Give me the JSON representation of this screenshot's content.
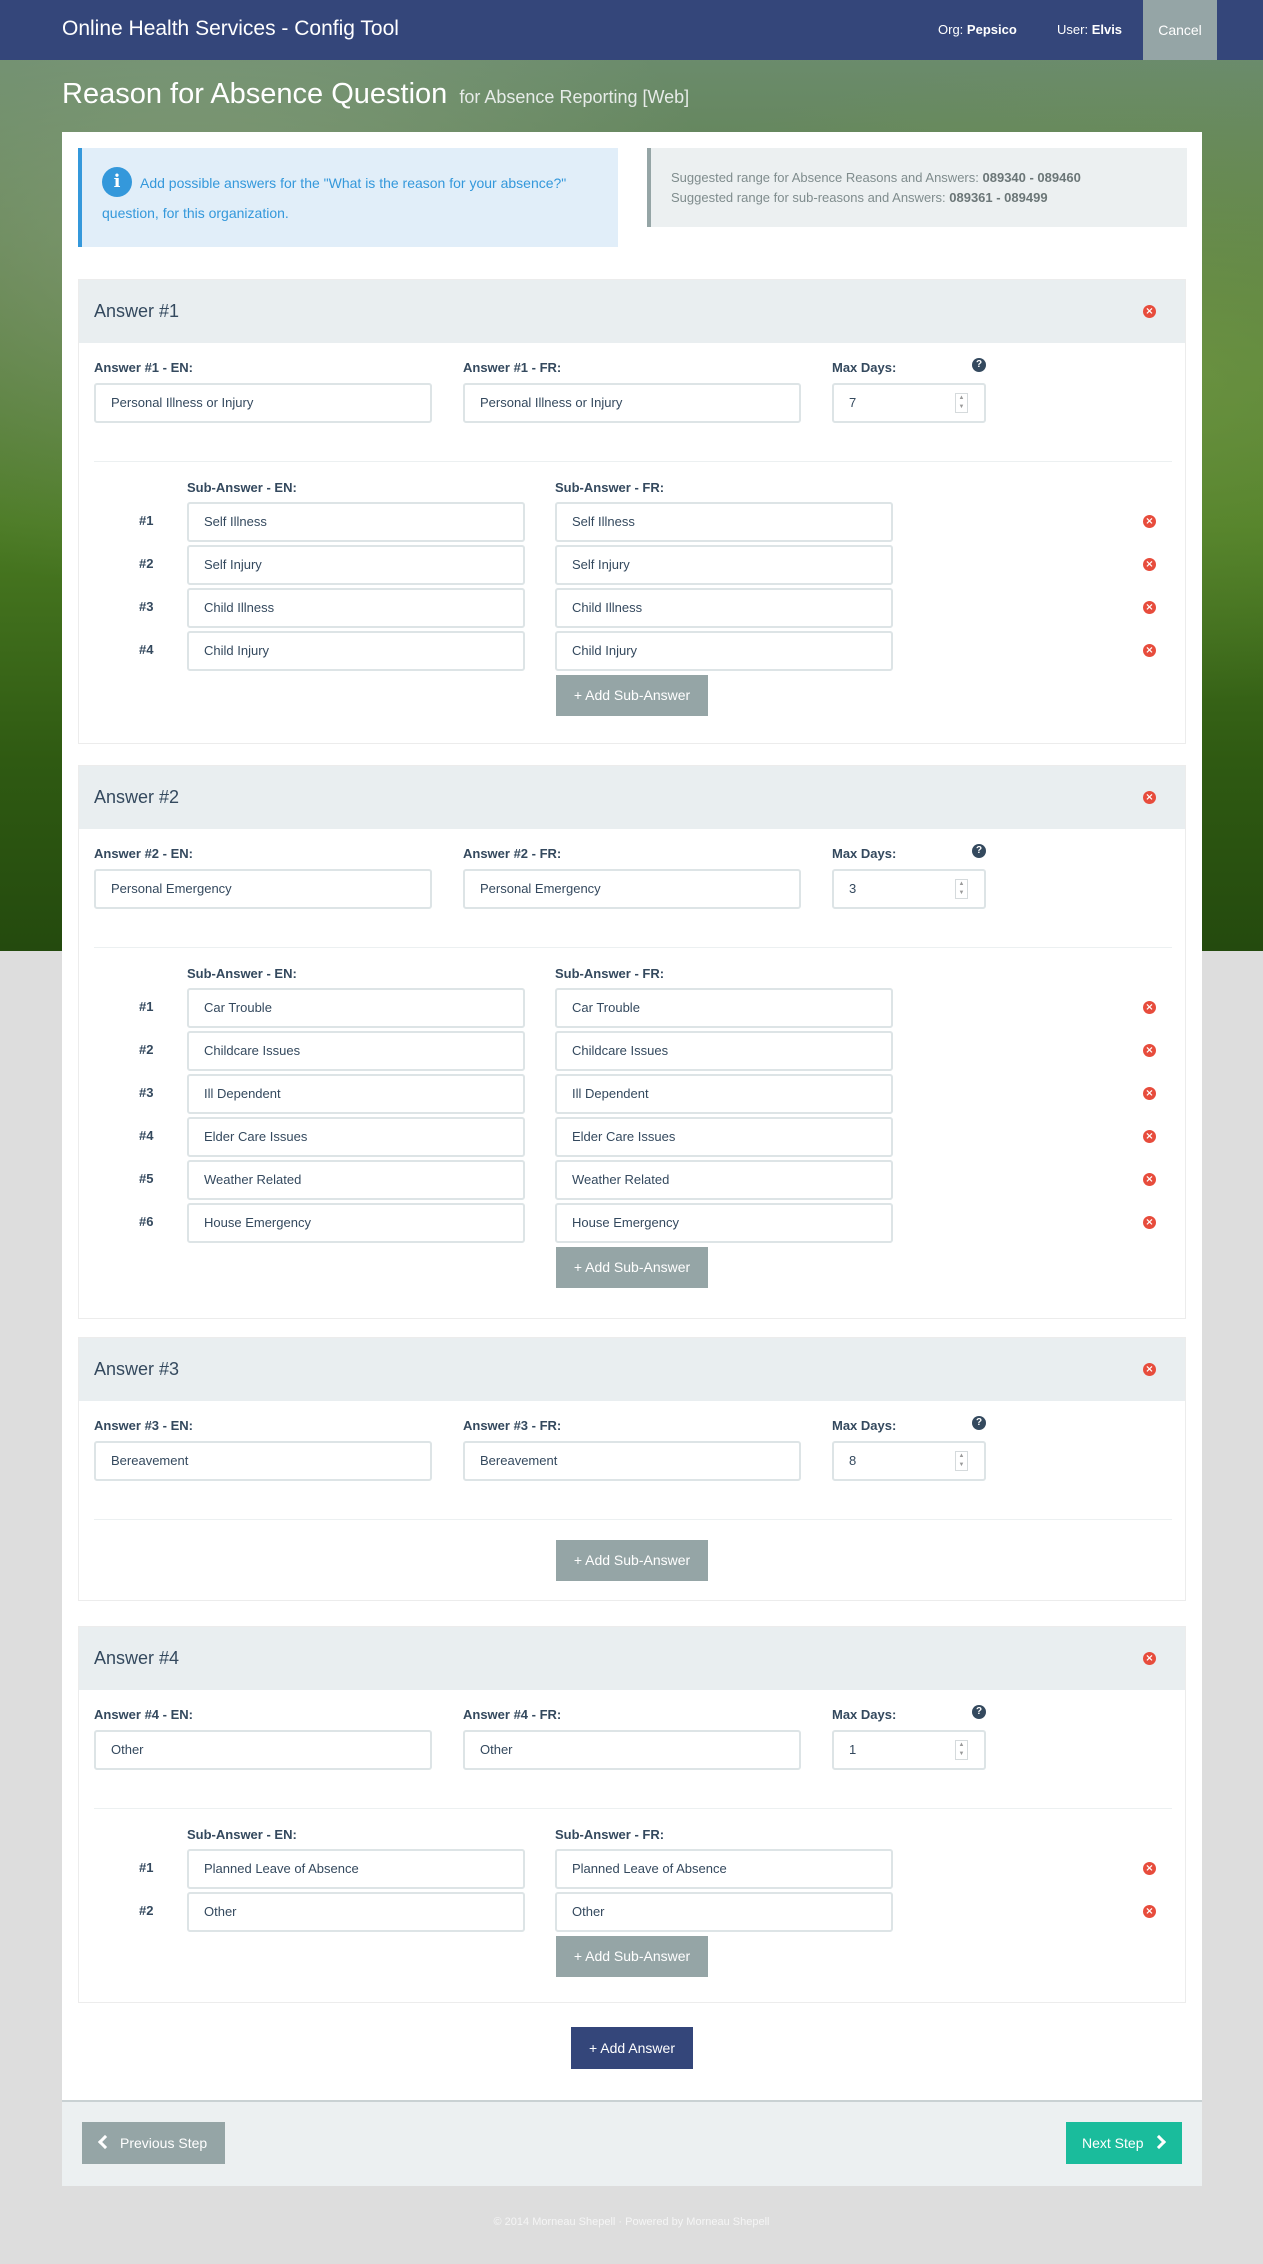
{
  "app": {
    "title": "Online Health Services - Config Tool"
  },
  "nav": {
    "org_label": "Org:",
    "org_value": "Pepsico",
    "user_label": "User:",
    "user_value": "Elvis",
    "cancel_label": "Cancel"
  },
  "page": {
    "title": "Reason for Absence Question",
    "subtitle": "for Absence Reporting [Web]"
  },
  "info": {
    "text": "Add possible answers for the \"What is the reason for your absence?\" question, for this organization."
  },
  "range": {
    "line1_label": "Suggested range for Absence Reasons and Answers:",
    "line1_value": "089340 - 089460",
    "line2_label": "Suggested range for sub-reasons and Answers:",
    "line2_value": "089361 - 089499"
  },
  "common": {
    "max_days_label": "Max Days:",
    "sub_en_label": "Sub-Answer - EN:",
    "sub_fr_label": "Sub-Answer - FR:",
    "add_sub_label": "+ Add Sub-Answer",
    "add_answer_label": "+ Add Answer",
    "prev_label": "Previous Step",
    "next_label": "Next Step"
  },
  "answers": [
    {
      "title": "Answer #1",
      "en_label": "Answer #1 - EN:",
      "fr_label": "Answer #1 - FR:",
      "en": "Personal Illness or Injury",
      "fr": "Personal Illness or Injury",
      "max_days": "7",
      "subs": [
        {
          "num": "#1",
          "en": "Self Illness",
          "fr": "Self Illness"
        },
        {
          "num": "#2",
          "en": "Self Injury",
          "fr": "Self Injury"
        },
        {
          "num": "#3",
          "en": "Child Illness",
          "fr": "Child Illness"
        },
        {
          "num": "#4",
          "en": "Child Injury",
          "fr": "Child Injury"
        }
      ]
    },
    {
      "title": "Answer #2",
      "en_label": "Answer #2 - EN:",
      "fr_label": "Answer #2 - FR:",
      "en": "Personal Emergency",
      "fr": "Personal Emergency",
      "max_days": "3",
      "subs": [
        {
          "num": "#1",
          "en": "Car Trouble",
          "fr": "Car Trouble"
        },
        {
          "num": "#2",
          "en": "Childcare Issues",
          "fr": "Childcare Issues"
        },
        {
          "num": "#3",
          "en": "Ill Dependent",
          "fr": "Ill Dependent"
        },
        {
          "num": "#4",
          "en": "Elder Care Issues",
          "fr": "Elder Care Issues"
        },
        {
          "num": "#5",
          "en": "Weather Related",
          "fr": "Weather Related"
        },
        {
          "num": "#6",
          "en": "House Emergency",
          "fr": "House Emergency"
        }
      ]
    },
    {
      "title": "Answer #3",
      "en_label": "Answer #3 - EN:",
      "fr_label": "Answer #3 - FR:",
      "en": "Bereavement",
      "fr": "Bereavement",
      "max_days": "8",
      "subs": []
    },
    {
      "title": "Answer #4",
      "en_label": "Answer #4 - EN:",
      "fr_label": "Answer #4 - FR:",
      "en": "Other",
      "fr": "Other",
      "max_days": "1",
      "subs": [
        {
          "num": "#1",
          "en": "Planned Leave of Absence",
          "fr": "Planned Leave of Absence"
        },
        {
          "num": "#2",
          "en": "Other",
          "fr": "Other"
        }
      ]
    }
  ],
  "footer": {
    "copyright": "© 2014 Morneau Shepell  ·  Powered by Morneau Shepell"
  }
}
